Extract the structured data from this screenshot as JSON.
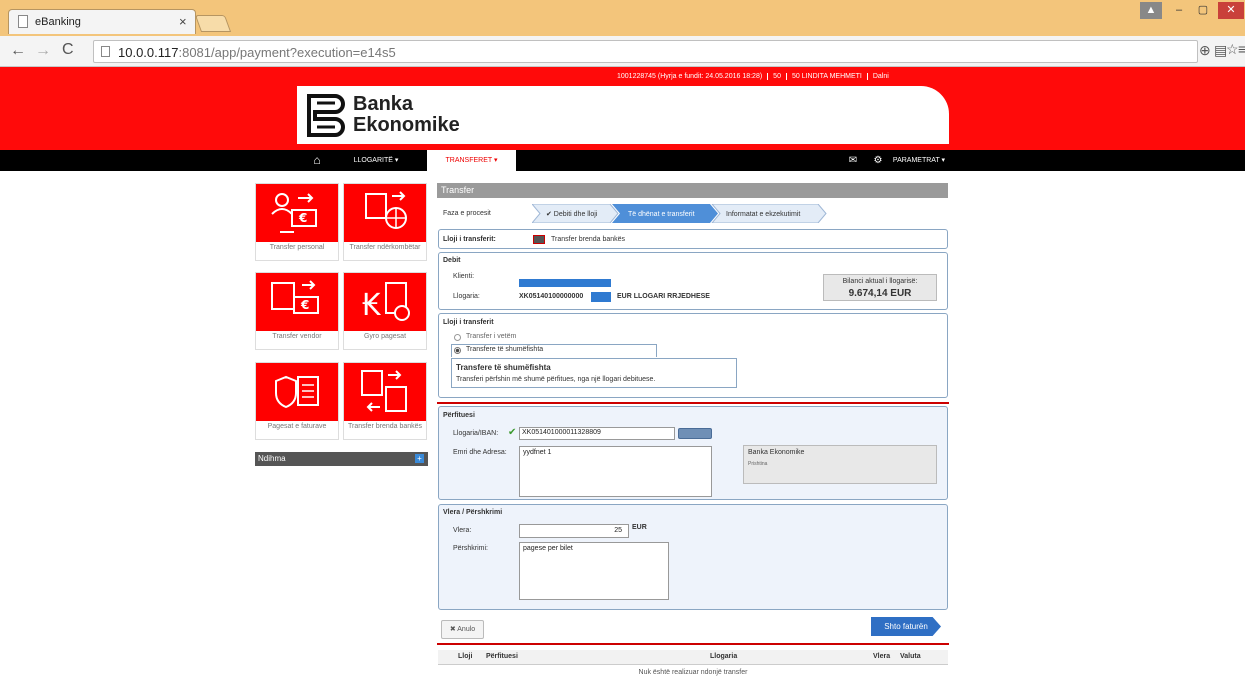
{
  "browser": {
    "tab_title": "eBanking",
    "url_host": "10.0.0.117",
    "url_rest": ":8081/app/payment?execution=e14s5"
  },
  "header": {
    "user_info": "1001228745 (Hyrja e fundit: 24.05.2016 18:28)",
    "user_code": "50",
    "user_name": "50 LINDITA MEHMETI",
    "logout": "Dalni",
    "logo_line1": "Banka",
    "logo_line2": "Ekonomike"
  },
  "nav": {
    "accounts": "LLOGARITË ▾",
    "transfers": "TRANSFERET ▾",
    "params": "PARAMETRAT ▾"
  },
  "tiles": [
    {
      "label": "Transfer personal"
    },
    {
      "label": "Transfer ndërkombëtar"
    },
    {
      "label": "Transfer vendor"
    },
    {
      "label": "Gyro pagesat"
    },
    {
      "label": "Pagesat e faturave"
    },
    {
      "label": "Transfer brenda bankës"
    }
  ],
  "help": {
    "label": "Ndihma"
  },
  "panel": {
    "title": "Transfer",
    "phase_label": "Faza e procesit",
    "steps": [
      "✔ Debiti dhe lloji",
      "Të dhënat e transferit",
      "Informatat e ekzekutimit"
    ],
    "transfer_type_label": "Lloji i transferit:",
    "transfer_type_value": "Transfer brenda bankës",
    "debit": {
      "title": "Debit",
      "client_label": "Klienti:",
      "account_label": "Llogaria:",
      "account_value": "XK05140100000000",
      "account_type": "EUR LLOGARI RRJEDHESE",
      "balance_label": "Bilanci aktual i llogarisë:",
      "balance_value": "9.674,14 EUR"
    },
    "type": {
      "title": "Lloji i transferit",
      "option1": "Transfer i vetëm",
      "option2": "Transfere të shumëfishta",
      "info_title": "Transfere të shumëfishta",
      "info_text": "Transferi përfshin më shumë përfitues, nga një llogari debituese."
    },
    "beneficiary": {
      "title": "Përfituesi",
      "iban_label": "Llogaria/IBAN:",
      "iban_value": "XK051401000011328809",
      "name_label": "Emri dhe Adresa:",
      "name_value": "yydfnet 1",
      "bank_name": "Banka Ekonomike",
      "bank_city": "Prishtina"
    },
    "amount": {
      "title": "Vlera / Përshkrimi",
      "amount_label": "Vlera:",
      "amount_value": "25",
      "currency": "EUR",
      "desc_label": "Përshkrimi:",
      "desc_value": "pagese per bilet"
    },
    "cancel": "✖ Anulo",
    "add_invoice": "Shto faturën",
    "table": {
      "headers": [
        "Lloji",
        "Përfituesi",
        "Llogaria",
        "Vlera",
        "Valuta"
      ],
      "empty": "Nuk është realizuar ndonjë transfer"
    }
  }
}
